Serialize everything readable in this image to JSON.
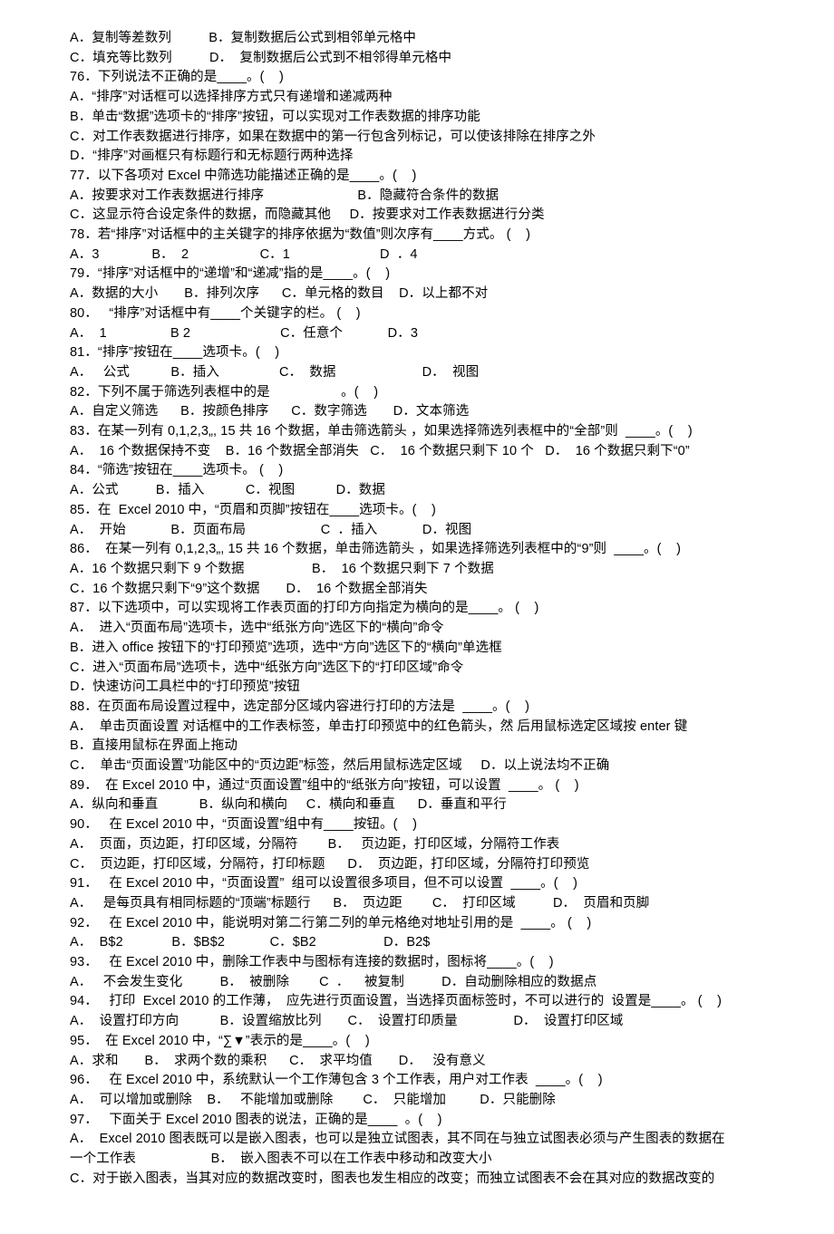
{
  "lines": [
    "A．复制等差数列          B．复制数据后公式到相邻单元格中",
    "C．填充等比数列          D．  复制数据后公式到不相邻得单元格中",
    "76．下列说法不正确的是____。(    )",
    "A．“排序”对话框可以选择排序方式只有递增和递减两种",
    "B．单击“数据”选项卡的“排序”按钮，可以实现对工作表数据的排序功能",
    "C．对工作表数据进行排序，如果在数据中的第一行包含列标记，可以使该排除在排序之外",
    "D．“排序”对画框只有标题行和无标题行两种选择",
    "77．以下各项对 Excel 中筛选功能描述正确的是____。(    )",
    "A．按要求对工作表数据进行排序                         B．隐藏符合条件的数据",
    "C．这显示符合设定条件的数据，而隐藏其他     D．按要求对工作表数据进行分类",
    "78．若“排序”对话框中的主关键字的排序依据为“数值”则次序有____方式。 (    )",
    "A．3              B．  2                   C．1                        D  ．4",
    "79．“排序”对话框中的“递增”和“递减”指的是____。(    )",
    "A．数据的大小       B．排列次序      C．单元格的数目    D．以上都不对",
    "80．   “排序”对话框中有____个关键字的栏。 (    )",
    "A．  1                 B 2                        C．任意个            D．3",
    "81．“排序”按钮在____选项卡。(    )",
    "A．   公式           B．插入                C．  数据                       D．  视图",
    "82．下列不属于筛选列表框中的是                   。(    )",
    "A．自定义筛选      B．按颜色排序      C．数字筛选       D．文本筛选",
    "83．在某一列有 0,1,2,3„, 15 共 16 个数据，单击筛选箭头 ，如果选择筛选列表框中的“全部”则  ____。(    )",
    "A．  16 个数据保持不变    B．16 个数据全部消失   C．  16 个数据只剩下 10 个   D．  16 个数据只剩下“0”",
    "84．“筛选”按钮在____选项卡。 (    )",
    "A．公式          B．插入           C．视图           D．数据",
    "85．在  Excel 2010 中，“页眉和页脚”按钮在____选项卡。(    )",
    "A．  开始            B．页面布局                    C  ．插入            D．视图",
    "86．  在某一列有 0,1,2,3„, 15 共 16 个数据，单击筛选箭头 ，如果选择筛选列表框中的“9”则  ____。(    )",
    "A．16 个数据只剩下 9 个数据                  B．  16 个数据只剩下 7 个数据",
    "C．16 个数据只剩下“9”这个数据       D．  16 个数据全部消失",
    "87．以下选项中，可以实现将工作表页面的打印方向指定为横向的是____。 (    )",
    "A．  进入“页面布局”选项卡，选中“纸张方向”选区下的“横向”命令",
    "B．进入 office 按钮下的“打印预览”选项，选中“方向”选区下的“横向”单选框",
    "C．进入“页面布局”选项卡，选中“纸张方向”选区下的“打印区域”命令",
    "D．快速访问工具栏中的“打印预览”按钮",
    "88．在页面布局设置过程中，选定部分区域内容进行打印的方法是  ____。(    )",
    "A．  单击页面设置 对话框中的工作表标签，单击打印预览中的红色箭头，然 后用鼠标选定区域按 enter 键",
    "B．直接用鼠标在界面上拖动",
    "C．  单击“页面设置”功能区中的“页边距”标签，然后用鼠标选定区域     D．以上说法均不正确",
    "89．  在 Excel 2010 中，通过“页面设置”组中的“纸张方向”按钮，可以设置  ____。 (    )",
    "A．纵向和垂直           B．纵向和横向     C．横向和垂直      D．垂直和平行",
    "90．   在 Excel 2010 中，“页面设置”组中有____按钮。(    )",
    "A．  页面，页边距，打印区域，分隔符        B．   页边距，打印区域，分隔符工作表",
    "C．  页边距，打印区域，分隔符，打印标题      D．  页边距，打印区域，分隔符打印预览",
    "91．   在 Excel 2010 中，“页面设置”  组可以设置很多项目，但不可以设置  ____。(    )",
    "A．   是每页具有相同标题的“顶端”标题行      B．  页边距        C．  打印区域          D．  页眉和页脚",
    "92．   在 Excel 2010 中，能说明对第二行第二列的单元格绝对地址引用的是  ____。 (    )",
    "A．  B$2             B．$B$2            C．$B2                  D．B2$",
    "93．   在 Excel 2010 中，删除工作表中与图标有连接的数据时，图标将____。(    )",
    "A．   不会发生变化          B．  被删除        C  ．    被复制          D．自动删除相应的数据点",
    "94．   打印  Excel 2010 的工作薄，  应先进行页面设置，当选择页面标签时，不可以进行的  设置是____。 (    )",
    "A．  设置打印方向           B．设置缩放比列       C．  设置打印质量               D．  设置打印区域",
    "95．  在 Excel 2010 中，“∑▼”表示的是____。(    )",
    "A．求和       B．  求两个数的乘积      C．  求平均值       D．   没有意义",
    "96．   在 Excel 2010 中，系统默认一个工作薄包含 3 个工作表，用户对工作表  ____。(    )",
    "A．  可以增加或删除    B．   不能增加或删除        C．  只能增加         D．只能删除",
    "97．   下面关于 Excel 2010 图表的说法，正确的是____  。(    )",
    "A．  Excel 2010 图表既可以是嵌入图表，也可以是独立试图表，其不同在与独立试图表必须与产生图表的数据在",
    "一个工作表                    B．  嵌入图表不可以在工作表中移动和改变大小",
    "C．对于嵌入图表，当其对应的数据改变时，图表也发生相应的改变；而独立试图表不会在其对应的数据改变的"
  ]
}
